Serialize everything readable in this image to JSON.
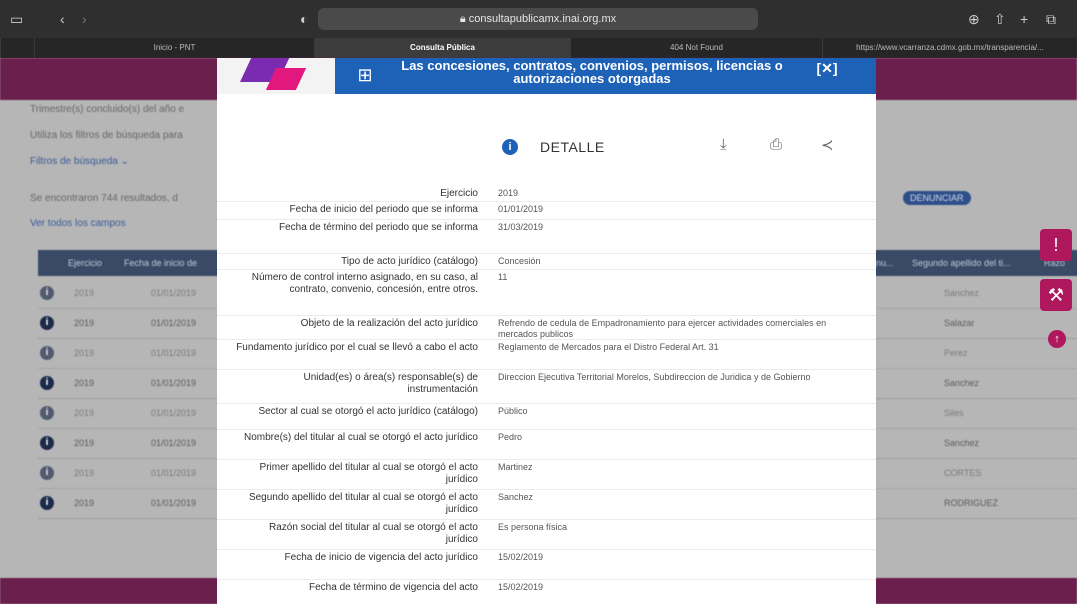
{
  "browser": {
    "url": "consultapublicamx.inai.org.mx",
    "tabs": [
      {
        "label": "Inicio - PNT",
        "active": false
      },
      {
        "label": "Consulta Pública",
        "active": true
      },
      {
        "label": "404 Not Found",
        "active": false
      },
      {
        "label": "https://www.vcarranza.cdmx.gob.mx/transparencia/...",
        "active": false
      }
    ]
  },
  "background": {
    "intro_lines": [
      "Trimestre(s) concluido(s) del año e",
      "Utiliza los filtros de búsqueda para"
    ],
    "filters_label": "Filtros de búsqueda",
    "results_text": "Se encontraron 744 resultados, d",
    "view_all_label": "Ver todos los campos",
    "denunciar_label": "DENUNCIAR",
    "columns": [
      "Ejercicio",
      "Fecha de inicio de",
      "nu...",
      "Segundo apellido del ti...",
      "Razó"
    ],
    "rows": [
      {
        "year": "2019",
        "date": "01/01/2019",
        "surname": "Sanchez"
      },
      {
        "year": "2019",
        "date": "01/01/2019",
        "surname": "Salazar"
      },
      {
        "year": "2019",
        "date": "01/01/2019",
        "surname": "Perez"
      },
      {
        "year": "2019",
        "date": "01/01/2019",
        "surname": "Sanchez"
      },
      {
        "year": "2019",
        "date": "01/01/2019",
        "surname": "Siles"
      },
      {
        "year": "2019",
        "date": "01/01/2019",
        "surname": "Sanchez"
      },
      {
        "year": "2019",
        "date": "01/01/2019",
        "surname": "CORTES"
      },
      {
        "year": "2019",
        "date": "01/01/2019",
        "surname": "RODRIGUEZ"
      }
    ]
  },
  "modal": {
    "header_title": "Las concesiones, contratos, convenios, permisos, licencias o autorizaciones otorgadas",
    "detail_title": "DETALLE",
    "fields": [
      {
        "label": "Ejercicio",
        "value": "2019"
      },
      {
        "label": "Fecha de inicio del periodo que se informa",
        "value": "01/01/2019"
      },
      {
        "label": "Fecha de término del periodo que se informa",
        "value": "31/03/2019"
      },
      {
        "label": "Tipo de acto jurídico (catálogo)",
        "value": "Concesión"
      },
      {
        "label": "Número de control interno asignado, en su caso, al contrato, convenio, concesión, entre otros.",
        "value": "11"
      },
      {
        "label": "Objeto de la realización del acto jurídico",
        "value": "Refrendo de cedula de Empadronamiento para ejercer actividades comerciales en mercados publicos"
      },
      {
        "label": "Fundamento jurídico por el cual se llevó a cabo el acto",
        "value": "Reglamento de Mercados para el Distro Federal Art. 31"
      },
      {
        "label": "Unidad(es) o área(s) responsable(s) de instrumentación",
        "value": "Direccion Ejecutiva Territorial Morelos, Subdireccion de Juridica y de Gobierno"
      },
      {
        "label": "Sector al cual se otorgó el acto jurídico (catálogo)",
        "value": "Público"
      },
      {
        "label": "Nombre(s) del titular al cual se otorgó el acto jurídico",
        "value": "Pedro"
      },
      {
        "label": "Primer apellido del titular al cual se otorgó el acto jurídico",
        "value": "Martinez"
      },
      {
        "label": "Segundo apellido del titular al cual se otorgó el acto jurídico",
        "value": "Sanchez"
      },
      {
        "label": "Razón social del titular al cual se otorgó el acto jurídico",
        "value": "Es persona física"
      },
      {
        "label": "Fecha de inicio de vigencia del acto jurídico",
        "value": "15/02/2019"
      },
      {
        "label": "Fecha de término de vigencia del acto",
        "value": "15/02/2019"
      }
    ]
  }
}
